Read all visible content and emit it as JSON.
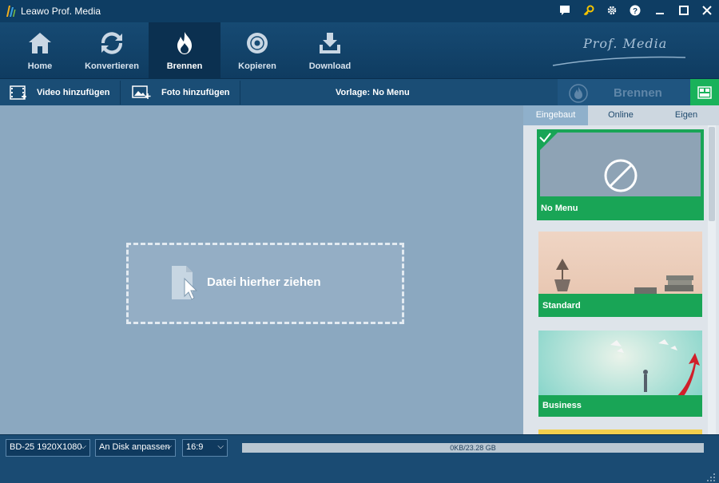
{
  "window": {
    "title": "Leawo Prof. Media"
  },
  "titlebar_icons": [
    "chat-icon",
    "key-icon",
    "gear-icon",
    "help-icon",
    "minimize-icon",
    "maximize-icon",
    "close-icon"
  ],
  "nav": {
    "items": [
      {
        "label": "Home",
        "icon": "home-icon"
      },
      {
        "label": "Konvertieren",
        "icon": "convert-icon"
      },
      {
        "label": "Brennen",
        "icon": "flame-icon",
        "active": true
      },
      {
        "label": "Kopieren",
        "icon": "disc-icon"
      },
      {
        "label": "Download",
        "icon": "download-icon"
      }
    ],
    "brand": "Prof. Media"
  },
  "toolbar": {
    "add_video": "Video hinzufügen",
    "add_photo": "Foto hinzufügen",
    "template": "Vorlage: No Menu",
    "burn": "Brennen"
  },
  "main": {
    "drop_text": "Datei hierher ziehen"
  },
  "panel": {
    "tabs": [
      {
        "label": "Eingebaut",
        "active": true
      },
      {
        "label": "Online"
      },
      {
        "label": "Eigen"
      }
    ],
    "templates": [
      {
        "label": "No Menu",
        "selected": true
      },
      {
        "label": "Standard"
      },
      {
        "label": "Business"
      }
    ]
  },
  "bottom": {
    "disc_type": "BD-25 1920X1080",
    "fit_mode": "An Disk anpassen",
    "aspect": "16:9",
    "capacity": "0KB/23.28 GB",
    "capacity_used_fraction": 0
  },
  "colors": {
    "accent_green": "#19b25a",
    "nav_dark": "#0b3050",
    "main_bg": "#8ba8c0"
  }
}
